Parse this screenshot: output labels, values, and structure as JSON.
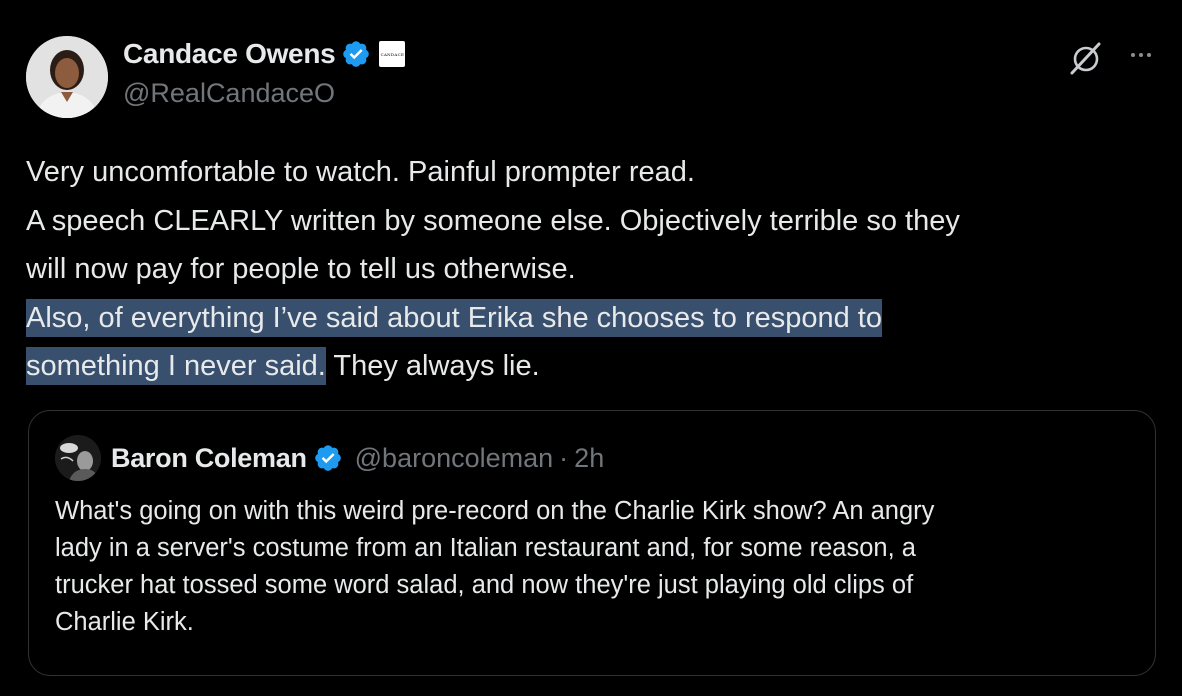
{
  "tweet": {
    "author_name": "Candace Owens",
    "author_handle": "@RealCandaceO",
    "affiliate_badge_text": "CANDACE",
    "text_lines": [
      "Very uncomfortable to watch. Painful prompter read.",
      "A speech CLEARLY written by someone else. Objectively terrible so they",
      "will now pay for people to tell us otherwise."
    ],
    "highlighted_line_1": "Also, of everything I’ve said about Erika she chooses to respond to ",
    "highlighted_line_2": "something I never said.",
    "after_highlight": " They always lie.",
    "icons": {
      "grok": "grok-icon",
      "more": "more-icon",
      "verified": "verified-badge-icon"
    }
  },
  "quote": {
    "author_name": "Baron Coleman",
    "author_handle": "@baroncoleman",
    "separator": "·",
    "time": "2h",
    "text_lines": [
      "What's going on with this weird pre-record on the Charlie Kirk show?  An angry",
      "lady in a server's costume from an Italian restaurant and, for some reason, a",
      "trucker hat tossed some word salad, and now they're just playing old clips of",
      "Charlie Kirk."
    ]
  },
  "colors": {
    "background": "#000000",
    "text": "#e7e9ea",
    "secondary_text": "#71767b",
    "verified_blue": "#1d9bf0",
    "selection_highlight": "#384f6e",
    "quote_border": "#2f3336"
  }
}
